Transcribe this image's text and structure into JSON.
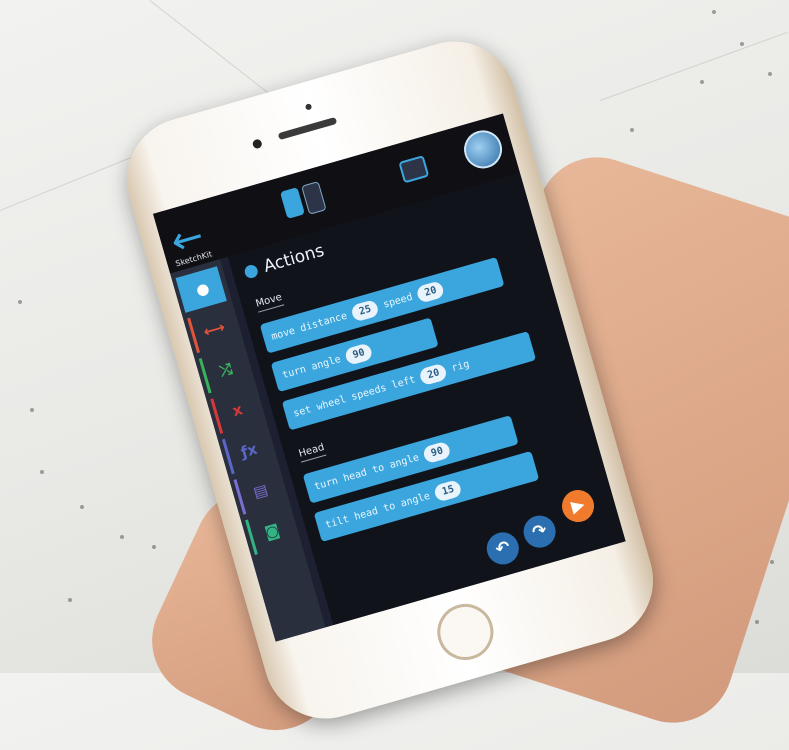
{
  "app": {
    "name": "SketchKit",
    "back_icon": "back-arrow-icon"
  },
  "toolbar": {
    "icons": [
      "blocks-view-icon",
      "text-view-icon",
      "device-icon",
      "avatar-icon"
    ],
    "accent_color": "#3ba6dd"
  },
  "sidebar": {
    "categories": [
      {
        "icon": "actions-icon",
        "glyph": "●",
        "color": "#ffffff",
        "accent": "#3ba6dd"
      },
      {
        "icon": "events-icon",
        "glyph": "⟷",
        "color": "#e0543b",
        "accent": "#e0543b"
      },
      {
        "icon": "control-icon",
        "glyph": "⤮",
        "color": "#38b35a",
        "accent": "#38b35a"
      },
      {
        "icon": "math-icon",
        "glyph": "x",
        "color": "#d7393a",
        "accent": "#d7393a"
      },
      {
        "icon": "functions-icon",
        "glyph": "ƒx",
        "color": "#5a67c8",
        "accent": "#5a67c8"
      },
      {
        "icon": "variables-icon",
        "glyph": "▤",
        "color": "#7b6fd1",
        "accent": "#7b6fd1"
      },
      {
        "icon": "sensing-icon",
        "glyph": "◙",
        "color": "#32b383",
        "accent": "#32b383"
      }
    ]
  },
  "flyout": {
    "title": "Actions",
    "sections": [
      {
        "label": "Move",
        "blocks": [
          {
            "parts": [
              "move",
              "distance"
            ],
            "value1": "25",
            "mid": "speed",
            "value2": "20"
          },
          {
            "parts": [
              "turn",
              "angle"
            ],
            "value1": "90"
          },
          {
            "parts": [
              "set wheel speeds",
              "left"
            ],
            "value1": "20",
            "mid": "rig"
          }
        ]
      },
      {
        "label": "Head",
        "blocks": [
          {
            "parts": [
              "turn head to",
              "angle"
            ],
            "value1": "90"
          },
          {
            "parts": [
              "tilt head to",
              "angle"
            ],
            "value1": "15"
          }
        ]
      }
    ]
  },
  "controls": {
    "undo_icon": "undo-icon",
    "redo_icon": "redo-icon",
    "play_icon": "play-icon",
    "play_color": "#f07b2c"
  }
}
